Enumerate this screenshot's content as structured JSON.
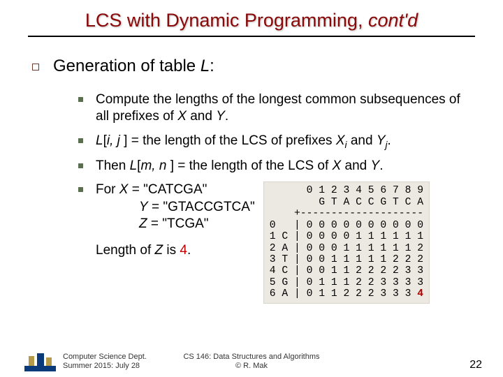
{
  "title_main": "LCS with Dynamic Programming, ",
  "title_ital": "cont'd",
  "h1_pre": "Generation of table ",
  "h1_var": "L",
  "h1_post": ":",
  "b1": "Compute the lengths of the longest common subsequences of all prefixes of ",
  "b1_x": "X",
  "b1_mid": " and ",
  "b1_y": "Y",
  "b1_end": ".",
  "b2_a": "L",
  "b2_b": "[",
  "b2_c": "i, j ",
  "b2_d": "] = the length of the LCS of prefixes ",
  "b2_e": "X",
  "b2_f": " and ",
  "b2_g": "Y",
  "b2_h": ".",
  "b3_a": "Then ",
  "b3_b": "L",
  "b3_c": "[",
  "b3_d": "m, n ",
  "b3_e": "] = the length of the LCS of ",
  "b3_f": "X",
  "b3_g": " and ",
  "b3_h": "Y",
  "b3_i": ".",
  "ex_x_lbl": "For ",
  "ex_x": "X",
  "ex_x_eq": " = \"CATCGA\"",
  "ex_y": "Y",
  "ex_y_eq": " = \"GTACCGTCA\"",
  "ex_z": "Z",
  "ex_z_eq": " = \"TCGA\"",
  "len_a": "Length of ",
  "len_b": "Z",
  "len_c": " is ",
  "len_d": "4",
  "len_e": ".",
  "table_lines": "      0 1 2 3 4 5 6 7 8 9\n        G T A C C G T C A\n    +--------------------\n0   | 0 0 0 0 0 0 0 0 0 0\n1 C | 0 0 0 0 1 1 1 1 1 1\n2 A | 0 0 0 1 1 1 1 1 1 2\n3 T | 0 0 1 1 1 1 1 2 2 2\n4 C | 0 0 1 1 2 2 2 2 3 3\n5 G | 0 1 1 1 2 2 3 3 3 3\n6 A | 0 1 1 2 2 2 3 3 3 ",
  "table_last": "4",
  "footer_left_1": "Computer Science Dept.",
  "footer_left_2": "Summer 2015: July 28",
  "footer_center_1": "CS 146: Data Structures and Algorithms",
  "footer_center_2": "© R. Mak",
  "page_number": "22",
  "sub_i": "i",
  "sub_j": "j"
}
